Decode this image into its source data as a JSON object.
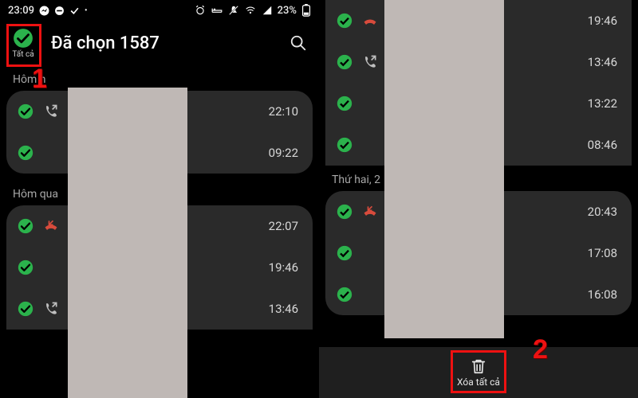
{
  "status": {
    "time": "23:09",
    "battery": "23%"
  },
  "header": {
    "select_all_label": "Tất cả",
    "title": "Đã chọn 1587"
  },
  "left": {
    "section1_label": "Hôm n",
    "section2_label": "Hôm qua",
    "rows_a": [
      {
        "time": "22:10",
        "call": "out"
      },
      {
        "time": "09:22",
        "call": "none"
      }
    ],
    "rows_b": [
      {
        "time": "22:07",
        "call": "missed"
      },
      {
        "time": "19:46",
        "call": "none"
      },
      {
        "time": "13:46",
        "call": "out"
      }
    ]
  },
  "right": {
    "section_label": "Thứ hai, 2",
    "rows_top": [
      {
        "time": "19:46",
        "call": "none"
      },
      {
        "time": "13:46",
        "call": "out"
      },
      {
        "time": "13:22",
        "call": "none"
      },
      {
        "time": "08:46",
        "call": "none"
      }
    ],
    "rows_bottom": [
      {
        "time": "20:43",
        "call": "missed"
      },
      {
        "time": "17:08",
        "call": "none"
      },
      {
        "time": "16:08",
        "call": "none"
      }
    ]
  },
  "footer": {
    "delete_label": "Xóa tất cả"
  },
  "anno": {
    "one": "1",
    "two": "2"
  },
  "colors": {
    "accent": "#2bb24c",
    "missed": "#d84b3c"
  }
}
